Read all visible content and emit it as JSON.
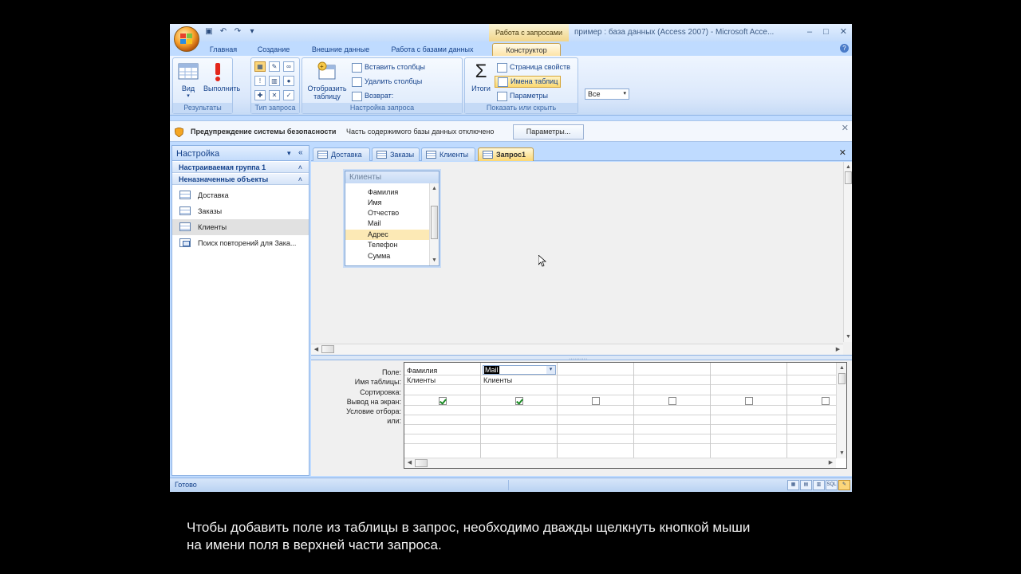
{
  "window": {
    "title": "пример : база данных (Access 2007) - Microsoft Acce...",
    "context_title": "Работа с запросами",
    "controls": [
      "–",
      "□",
      "✕"
    ]
  },
  "quick_access": [
    "save",
    "undo",
    "redo",
    "customize"
  ],
  "ribbon_tabs": [
    {
      "label": "Главная",
      "active": false
    },
    {
      "label": "Создание",
      "active": false
    },
    {
      "label": "Внешние данные",
      "active": false
    },
    {
      "label": "Работа с базами данных",
      "active": false
    },
    {
      "label": "Конструктор",
      "active": true
    }
  ],
  "ribbon": {
    "results": {
      "label": "Результаты",
      "view": "Вид",
      "run": "Выполнить"
    },
    "query_type": {
      "label": "Тип запроса"
    },
    "setup": {
      "label": "Настройка запроса",
      "show_table": "Отобразить таблицу",
      "insert_columns": "Вставить столбцы",
      "delete_columns": "Удалить столбцы",
      "return_label": "Возврат:",
      "return_value": "Все"
    },
    "show_hide": {
      "label": "Показать или скрыть",
      "totals": "Итоги",
      "property_sheet": "Страница свойств",
      "table_names": "Имена таблиц",
      "parameters": "Параметры"
    }
  },
  "security_bar": {
    "title": "Предупреждение системы безопасности",
    "message": "Часть содержимого базы данных отключено",
    "button": "Параметры..."
  },
  "nav": {
    "title": "Настройка",
    "groups": [
      {
        "label": "Настраиваемая группа 1"
      },
      {
        "label": "Неназначенные объекты"
      }
    ],
    "items": [
      {
        "label": "Доставка",
        "type": "table",
        "selected": false
      },
      {
        "label": "Заказы",
        "type": "table",
        "selected": false
      },
      {
        "label": "Клиенты",
        "type": "table",
        "selected": true
      },
      {
        "label": "Поиск повторений для Зака...",
        "type": "query",
        "selected": false
      }
    ]
  },
  "doc_tabs": [
    {
      "label": "Доставка",
      "active": false
    },
    {
      "label": "Заказы",
      "active": false
    },
    {
      "label": "Клиенты",
      "active": false
    },
    {
      "label": "Запрос1",
      "active": true
    }
  ],
  "table_box": {
    "title": "Клиенты",
    "fields": [
      "Фамилия",
      "Имя",
      "Отчество",
      "Mail",
      "Адрес",
      "Телефон",
      "Сумма"
    ],
    "hover_index": 4
  },
  "design_grid": {
    "row_labels": [
      "Поле:",
      "Имя таблицы:",
      "Сортировка:",
      "Вывод на экран:",
      "Условие отбора:",
      "или:"
    ],
    "columns": [
      {
        "field": "Фамилия",
        "table": "Клиенты",
        "show": true
      },
      {
        "field": "Mail",
        "table": "Клиенты",
        "show": true
      },
      {
        "field": "",
        "table": "",
        "show": false
      },
      {
        "field": "",
        "table": "",
        "show": false
      },
      {
        "field": "",
        "table": "",
        "show": false
      },
      {
        "field": "",
        "table": "",
        "show": false
      }
    ]
  },
  "status": {
    "text": "Готово"
  },
  "subtitle": {
    "line1": "Чтобы добавить поле из таблицы в запрос, необходимо дважды щелкнуть кнопкой мыши",
    "line2": "на имени поля в верхней части запроса."
  },
  "colors": {
    "accent": "#fbd773",
    "frame": "#bfdbff",
    "border": "#8db2e3"
  }
}
